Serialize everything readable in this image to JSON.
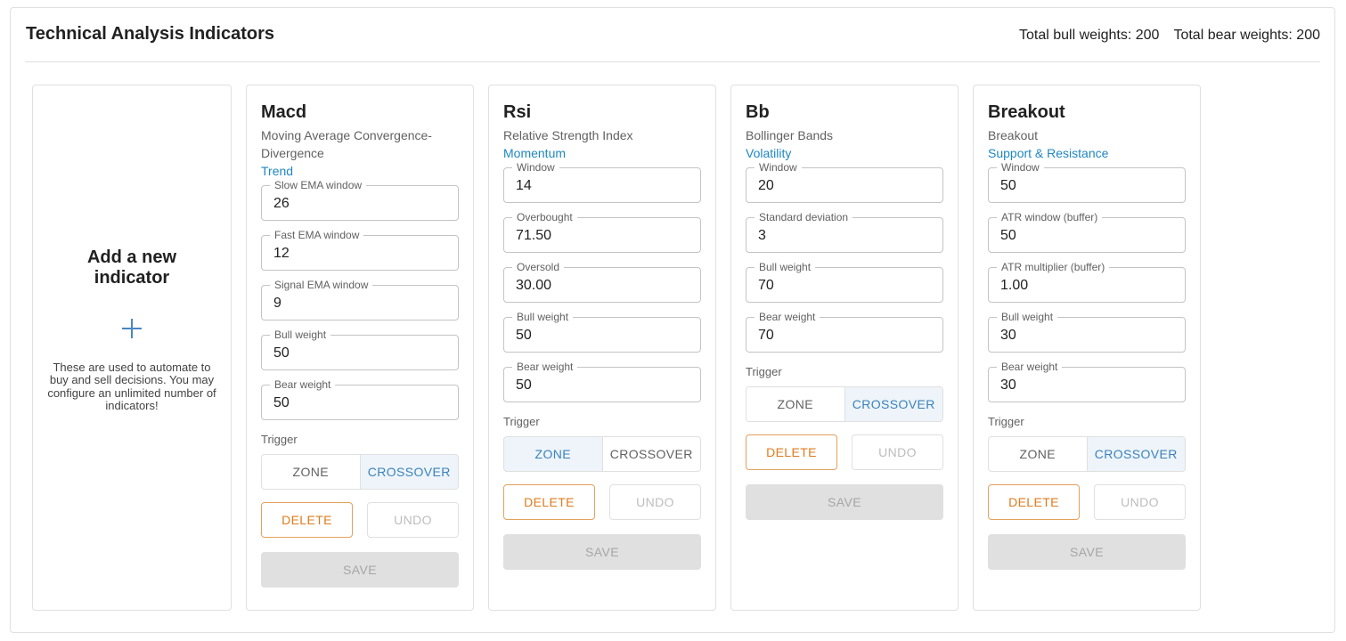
{
  "header": {
    "title": "Technical Analysis Indicators",
    "total_bull": "Total bull weights: 200",
    "total_bear": "Total bear weights: 200"
  },
  "add_card": {
    "title": "Add a new indicator",
    "icon": "plus-icon",
    "description": "These are used to automate to buy and sell decisions. You may configure an unlimited number of indicators!"
  },
  "indicators": [
    {
      "name": "Macd",
      "description": "Moving Average Convergence-Divergence",
      "category": "Trend",
      "fields": [
        {
          "label": "Slow EMA window",
          "value": "26"
        },
        {
          "label": "Fast EMA window",
          "value": "12"
        },
        {
          "label": "Signal EMA window",
          "value": "9"
        },
        {
          "label": "Bull weight",
          "value": "50"
        },
        {
          "label": "Bear weight",
          "value": "50"
        }
      ],
      "trigger_label": "Trigger",
      "trigger_options": [
        "ZONE",
        "CROSSOVER"
      ],
      "trigger_selected": "CROSSOVER",
      "delete_label": "DELETE",
      "undo_label": "UNDO",
      "save_label": "SAVE"
    },
    {
      "name": "Rsi",
      "description": "Relative Strength Index",
      "category": "Momentum",
      "fields": [
        {
          "label": "Window",
          "value": "14"
        },
        {
          "label": "Overbought",
          "value": "71.50"
        },
        {
          "label": "Oversold",
          "value": "30.00"
        },
        {
          "label": "Bull weight",
          "value": "50"
        },
        {
          "label": "Bear weight",
          "value": "50"
        }
      ],
      "trigger_label": "Trigger",
      "trigger_options": [
        "ZONE",
        "CROSSOVER"
      ],
      "trigger_selected": "ZONE",
      "delete_label": "DELETE",
      "undo_label": "UNDO",
      "save_label": "SAVE"
    },
    {
      "name": "Bb",
      "description": "Bollinger Bands",
      "category": "Volatility",
      "fields": [
        {
          "label": "Window",
          "value": "20"
        },
        {
          "label": "Standard deviation",
          "value": "3"
        },
        {
          "label": "Bull weight",
          "value": "70"
        },
        {
          "label": "Bear weight",
          "value": "70"
        }
      ],
      "trigger_label": "Trigger",
      "trigger_options": [
        "ZONE",
        "CROSSOVER"
      ],
      "trigger_selected": "CROSSOVER",
      "delete_label": "DELETE",
      "undo_label": "UNDO",
      "save_label": "SAVE"
    },
    {
      "name": "Breakout",
      "description": "Breakout",
      "category": "Support & Resistance",
      "fields": [
        {
          "label": "Window",
          "value": "50"
        },
        {
          "label": "ATR window (buffer)",
          "value": "50"
        },
        {
          "label": "ATR multiplier (buffer)",
          "value": "1.00"
        },
        {
          "label": "Bull weight",
          "value": "30"
        },
        {
          "label": "Bear weight",
          "value": "30"
        }
      ],
      "trigger_label": "Trigger",
      "trigger_options": [
        "ZONE",
        "CROSSOVER"
      ],
      "trigger_selected": "CROSSOVER",
      "delete_label": "DELETE",
      "undo_label": "UNDO",
      "save_label": "SAVE"
    }
  ],
  "colors": {
    "accent": "#1f86c0",
    "toggle_selected_bg": "#eef4f9",
    "delete": "#e07b1c",
    "disabled": "#bdbdbd"
  }
}
